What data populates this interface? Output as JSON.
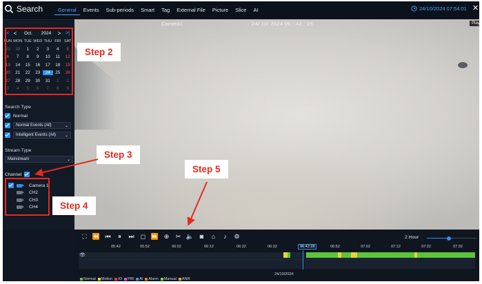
{
  "header": {
    "title": "Search",
    "tabs": [
      {
        "label": "General",
        "active": true
      },
      {
        "label": "Events",
        "active": false
      },
      {
        "label": "Sub-periods",
        "active": false
      },
      {
        "label": "Smart",
        "active": false
      },
      {
        "label": "Tag",
        "active": false
      },
      {
        "label": "External File",
        "active": false
      },
      {
        "label": "Picture",
        "active": false
      },
      {
        "label": "Slice",
        "active": false
      },
      {
        "label": "AI",
        "active": false
      }
    ],
    "datetime": "24/10/2024 07:54:01",
    "close_icon": "close-icon"
  },
  "calendar": {
    "prev_year": "|<",
    "prev_month": "<",
    "month": "Oct.",
    "year": "2024",
    "next_month": ">",
    "next_year": ">|",
    "weekdays": [
      "SUN",
      "MON",
      "TUE",
      "WED",
      "THU",
      "FRI",
      "SAT"
    ],
    "weeks": [
      [
        {
          "d": "29",
          "dim": true
        },
        {
          "d": "30",
          "dim": true
        },
        {
          "d": "1"
        },
        {
          "d": "2"
        },
        {
          "d": "3"
        },
        {
          "d": "4"
        },
        {
          "d": "5"
        }
      ],
      [
        {
          "d": "6"
        },
        {
          "d": "7"
        },
        {
          "d": "8"
        },
        {
          "d": "9"
        },
        {
          "d": "10"
        },
        {
          "d": "11"
        },
        {
          "d": "12"
        }
      ],
      [
        {
          "d": "13"
        },
        {
          "d": "14"
        },
        {
          "d": "15"
        },
        {
          "d": "16"
        },
        {
          "d": "17"
        },
        {
          "d": "18"
        },
        {
          "d": "19"
        }
      ],
      [
        {
          "d": "20"
        },
        {
          "d": "21"
        },
        {
          "d": "22"
        },
        {
          "d": "23"
        },
        {
          "d": "24",
          "selected": true
        },
        {
          "d": "25"
        },
        {
          "d": "26"
        }
      ],
      [
        {
          "d": "27"
        },
        {
          "d": "28"
        },
        {
          "d": "29"
        },
        {
          "d": "30"
        },
        {
          "d": "31"
        },
        {
          "d": "1",
          "dim": true
        },
        {
          "d": "2",
          "dim": true
        }
      ],
      [
        {
          "d": "3",
          "dim": true
        },
        {
          "d": "4",
          "dim": true
        },
        {
          "d": "5",
          "dim": true
        },
        {
          "d": "6",
          "dim": true
        },
        {
          "d": "7",
          "dim": true
        },
        {
          "d": "8",
          "dim": true
        },
        {
          "d": "9",
          "dim": true
        }
      ]
    ]
  },
  "search_type": {
    "label": "Search Type",
    "normal_label": "Normal",
    "normal_events": "Normal Events (All)",
    "intelligent_events": "Intelligent Events (All)"
  },
  "stream_type": {
    "label": "Stream Type",
    "value": "Mainstream"
  },
  "channel": {
    "label": "Channel",
    "channels": [
      {
        "name": "Camera 1",
        "checked": true
      },
      {
        "name": "CH2",
        "checked": false
      },
      {
        "name": "CH3",
        "checked": false
      },
      {
        "name": "CH4",
        "checked": false
      }
    ]
  },
  "video": {
    "camera_name": "Camera1",
    "timestamp": "24/ 10/ 2024   06 : 42 : 25",
    "play_label": "Play"
  },
  "playback": {
    "zoom_label": "2 Hour",
    "zoom_level": 0.45,
    "current_time": "06:42:28",
    "ruler_labels": [
      "05:42",
      "05:52",
      "06:02",
      "06:12",
      "06:22",
      "06:32",
      "06:42:28",
      "06:52",
      "07:02",
      "07:12",
      "07:22",
      "07:32"
    ],
    "date": "24/10/2024",
    "legend": [
      {
        "label": "Normal",
        "color": "#5cc43a"
      },
      {
        "label": "Motion",
        "color": "#e8d23a"
      },
      {
        "label": "IO",
        "color": "#e43a3a"
      },
      {
        "label": "PIR",
        "color": "#c65ad6"
      },
      {
        "label": "AI",
        "color": "#3a8fe8"
      },
      {
        "label": "Alarm",
        "color": "#e87a2a"
      },
      {
        "label": "Manual",
        "color": "#7ad64a"
      },
      {
        "label": "ANR",
        "color": "#e8a43a"
      }
    ]
  },
  "annotations": {
    "step2": "Step 2",
    "step3": "Step 3",
    "step4": "Step 4",
    "step5": "Step 5"
  },
  "colors": {
    "accent": "#2f8ff0",
    "annotation_red": "#e42a20",
    "weekend_red": "#ff5151"
  }
}
